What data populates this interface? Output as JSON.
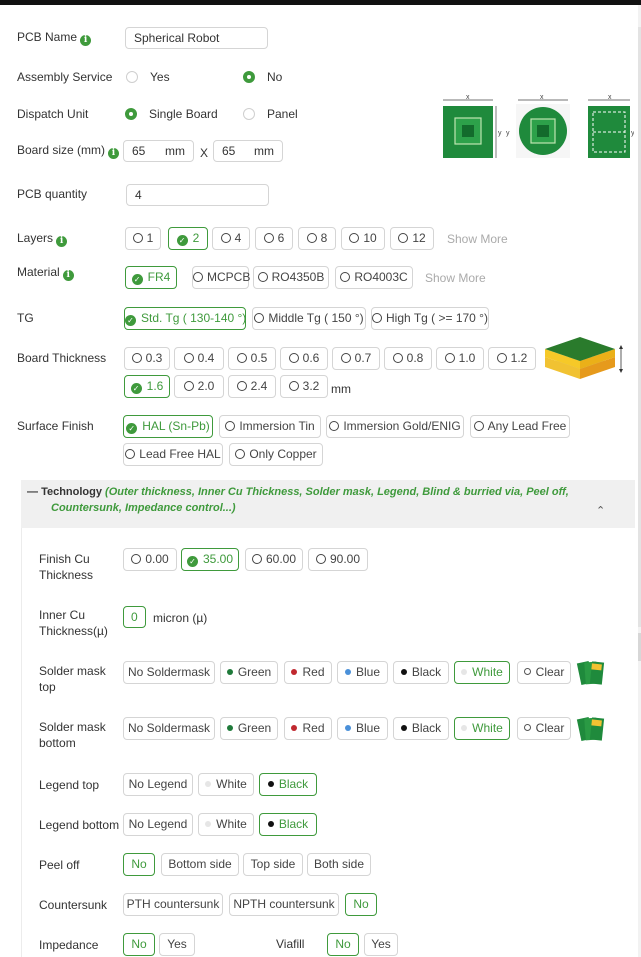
{
  "pcb_name": {
    "label": "PCB Name",
    "value": "Spherical Robot"
  },
  "assembly": {
    "label": "Assembly Service",
    "options": [
      "Yes",
      "No"
    ],
    "selected": "No"
  },
  "dispatch": {
    "label": "Dispatch Unit",
    "options": [
      "Single Board",
      "Panel"
    ],
    "selected": "Single Board"
  },
  "board_size": {
    "label": "Board size (mm)",
    "x": "65",
    "y": "65",
    "unit": "mm",
    "sep": "X"
  },
  "quantity": {
    "label": "PCB quantity",
    "value": "4"
  },
  "diagram": {
    "x": "x",
    "y": "y"
  },
  "layers": {
    "label": "Layers",
    "options": [
      "1",
      "2",
      "4",
      "6",
      "8",
      "10",
      "12"
    ],
    "selected": "2",
    "more": "Show More"
  },
  "material": {
    "label": "Material",
    "options": [
      "FR4",
      "MCPCB",
      "RO4350B",
      "RO4003C"
    ],
    "selected": "FR4",
    "more": "Show More"
  },
  "tg": {
    "label": "TG",
    "options": [
      "Std. Tg ( 130-140 °)",
      "Middle Tg ( 150 °)",
      "High Tg ( >= 170 °)"
    ],
    "selected": "Std. Tg ( 130-140 °)"
  },
  "thickness": {
    "label": "Board Thickness",
    "options": [
      "0.3",
      "0.4",
      "0.5",
      "0.6",
      "0.7",
      "0.8",
      "1.0",
      "1.2",
      "1.6",
      "2.0",
      "2.4",
      "3.2"
    ],
    "selected": "1.6",
    "unit": "mm"
  },
  "finish": {
    "label": "Surface Finish",
    "options": [
      "HAL (Sn-Pb)",
      "Immersion Tin",
      "Immersion Gold/ENIG",
      "Any Lead Free",
      "Lead Free HAL",
      "Only Copper"
    ],
    "selected": "HAL (Sn-Pb)"
  },
  "technology": {
    "dash": "—",
    "title": "Technology",
    "desc": "(Outer thickness, Inner Cu Thickness, Solder mask, Legend, Blind & burried via, Peel off, Countersunk, Impedance control...)"
  },
  "finish_cu": {
    "label": "Finish Cu Thickness",
    "options": [
      "0.00",
      "35.00",
      "60.00",
      "90.00"
    ],
    "selected": "35.00"
  },
  "inner_cu": {
    "label": "Inner Cu Thickness(µ)",
    "value": "0",
    "unit": "micron (µ)"
  },
  "mask_top": {
    "label": "Solder mask top",
    "options": [
      "No Soldermask",
      "Green",
      "Red",
      "Blue",
      "Black",
      "White",
      "Clear"
    ],
    "selected": "White"
  },
  "mask_bottom": {
    "label": "Solder mask bottom",
    "options": [
      "No Soldermask",
      "Green",
      "Red",
      "Blue",
      "Black",
      "White",
      "Clear"
    ],
    "selected": "White"
  },
  "legend_top": {
    "label": "Legend top",
    "options": [
      "No Legend",
      "White",
      "Black"
    ],
    "selected": "Black"
  },
  "legend_bottom": {
    "label": "Legend bottom",
    "options": [
      "No Legend",
      "White",
      "Black"
    ],
    "selected": "Black"
  },
  "peel": {
    "label": "Peel off",
    "options": [
      "No",
      "Bottom side",
      "Top side",
      "Both side"
    ],
    "selected": "No"
  },
  "countersunk": {
    "label": "Countersunk",
    "options": [
      "PTH countersunk",
      "NPTH countersunk",
      "No"
    ],
    "selected": "No"
  },
  "impedance": {
    "label": "Impedance",
    "options": [
      "No",
      "Yes"
    ],
    "selected": "No"
  },
  "viafill": {
    "label": "Viafill",
    "options": [
      "No",
      "Yes"
    ],
    "selected": "No"
  },
  "colors": {
    "accent": "#3f9a3c",
    "green": "#1f7a3a",
    "red": "#c0282f",
    "blue": "#4a90d9",
    "black": "#111111",
    "white": "#e6e6e6"
  }
}
